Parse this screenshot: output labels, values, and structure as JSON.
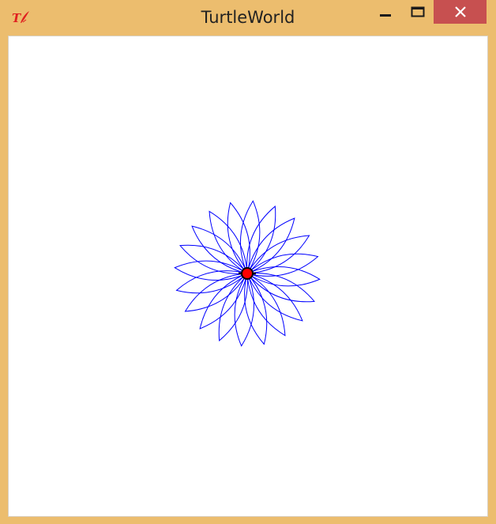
{
  "window": {
    "title": "TurtleWorld",
    "icon": "tk-feather-icon"
  },
  "controls": {
    "minimize_icon": "minimize-icon",
    "maximize_icon": "maximize-icon",
    "close_icon": "close-icon"
  },
  "colors": {
    "frame": "#ECBD6E",
    "close_button": "#C75050",
    "canvas": "#FFFFFF",
    "flower_stroke": "#0000FF",
    "turtle_fill": "#FF0000",
    "turtle_outline": "#000000"
  },
  "drawing": {
    "shape": "flower",
    "petals": 20,
    "stroke_color": "#0000FF",
    "turtle_color": "#FF0000"
  }
}
